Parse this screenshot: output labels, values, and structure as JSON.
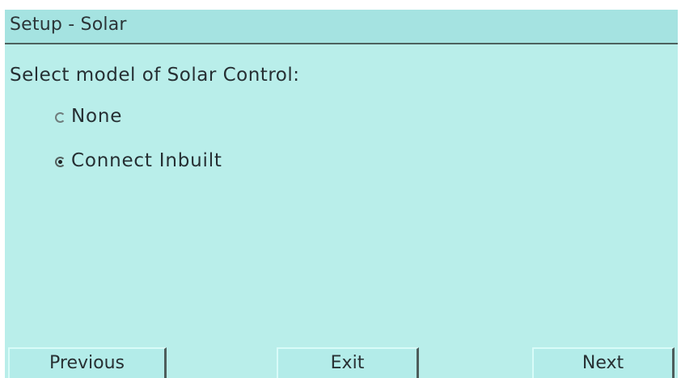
{
  "window": {
    "title": "Setup - Solar"
  },
  "main": {
    "prompt": "Select model of Solar Control:",
    "options": [
      {
        "label": "None",
        "selected": false
      },
      {
        "label": "Connect Inbuilt",
        "selected": true
      }
    ]
  },
  "buttons": {
    "previous": "Previous",
    "exit": "Exit",
    "next": "Next"
  },
  "colors": {
    "screen_background": "#b9eeea",
    "title_bar": "#a5e3e1",
    "text": "#262f33"
  }
}
